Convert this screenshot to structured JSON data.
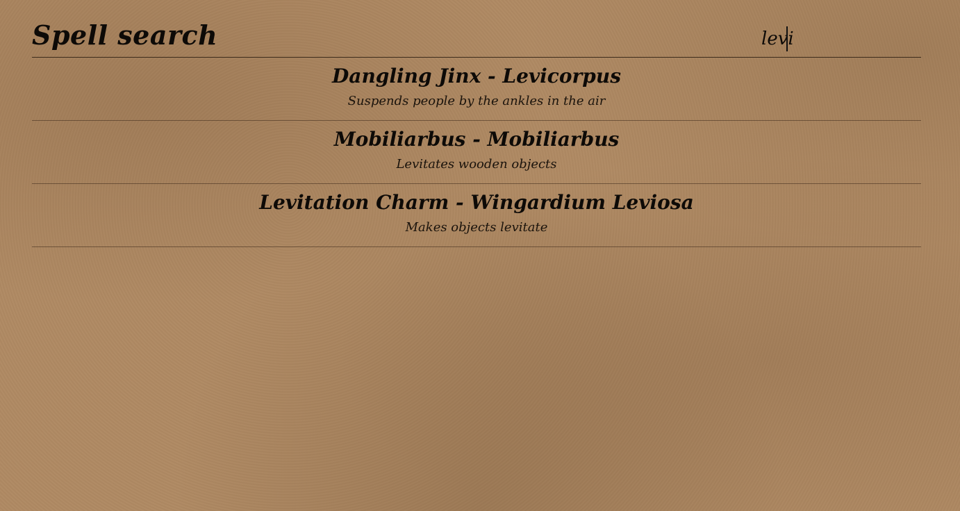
{
  "header": {
    "title": "Spell search"
  },
  "search": {
    "value": "levi"
  },
  "results": [
    {
      "title": "Dangling Jinx - Levicorpus",
      "description": "Suspends people by the ankles in the air"
    },
    {
      "title": "Mobiliarbus - Mobiliarbus",
      "description": "Levitates wooden objects"
    },
    {
      "title": "Levitation Charm - Wingardium Leviosa",
      "description": "Makes objects levitate"
    }
  ]
}
